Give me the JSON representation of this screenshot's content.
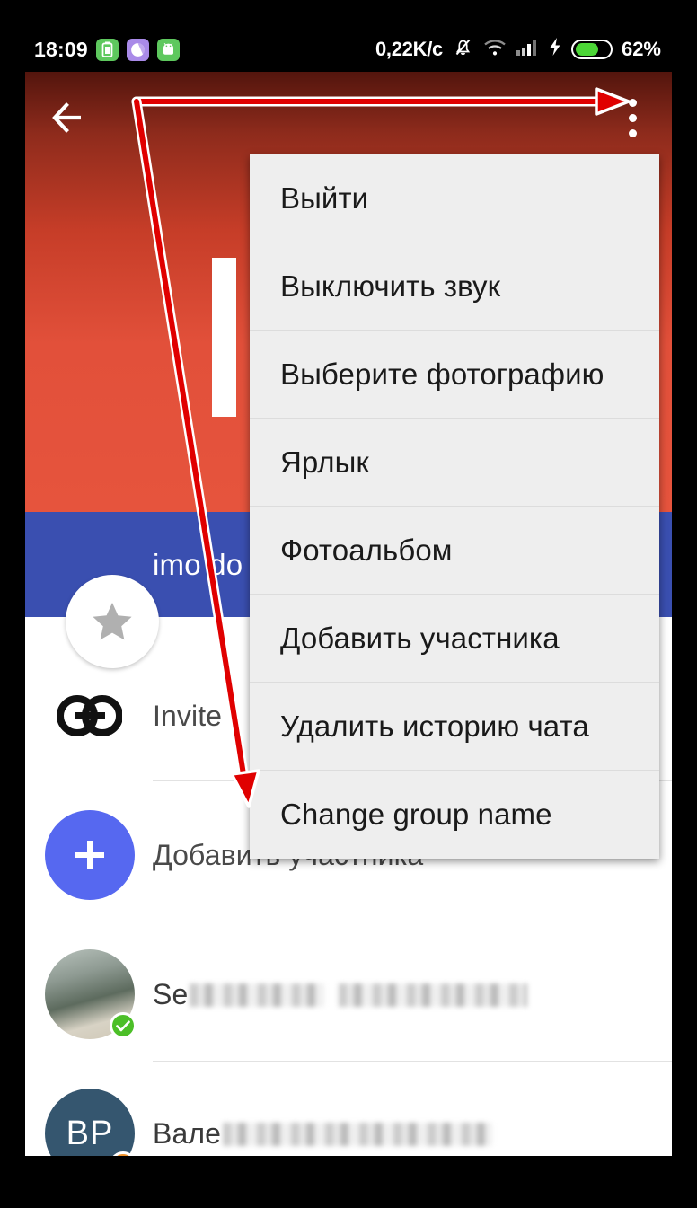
{
  "status_bar": {
    "clock": "18:09",
    "network_speed": "0,22K/c",
    "battery_percent": "62%",
    "icons": [
      {
        "name": "battery-saver-app-icon",
        "glyph": "battery"
      },
      {
        "name": "chat-app-icon",
        "glyph": "circle"
      },
      {
        "name": "android-robot-icon",
        "glyph": "android"
      },
      {
        "name": "mute-notifications-icon",
        "glyph": "bell-slash"
      },
      {
        "name": "wifi-icon",
        "glyph": "wifi"
      },
      {
        "name": "signal-bars-icon",
        "glyph": "signal"
      },
      {
        "name": "charging-bolt-icon",
        "glyph": "bolt"
      },
      {
        "name": "battery-icon",
        "glyph": "battery-full"
      }
    ],
    "battery_fill_percent": 62,
    "colors": {
      "background": "#000000",
      "text": "#ffffff",
      "battery_green": "#4cd637",
      "app_icon_green": "#5ec85e",
      "app_icon_purple": "#a98ae8"
    }
  },
  "app_bar": {
    "back_label": "←",
    "overflow_label": "⋮",
    "colors": {
      "gradient_top": "#53150d",
      "gradient_bottom": "#e6543d"
    }
  },
  "group_header": {
    "name": "imo do",
    "band_color": "#3a4fb0",
    "avatar_icon": "star-icon"
  },
  "overflow_menu": {
    "background": "#eeeeee",
    "items": [
      {
        "label": "Выйти",
        "name": "menu-item-leave"
      },
      {
        "label": "Выключить звук",
        "name": "menu-item-mute"
      },
      {
        "label": "Выберите фотографию",
        "name": "menu-item-choose-photo"
      },
      {
        "label": "Ярлык",
        "name": "menu-item-shortcut"
      },
      {
        "label": "Фотоальбом",
        "name": "menu-item-photo-album"
      },
      {
        "label": "Добавить участника",
        "name": "menu-item-add-member"
      },
      {
        "label": "Удалить историю чата",
        "name": "menu-item-delete-chat-history"
      },
      {
        "label": "Change group name",
        "name": "menu-item-change-group-name"
      }
    ]
  },
  "list": {
    "rows": [
      {
        "name": "row-invite-link",
        "label": "Invite",
        "icon": "link-icon",
        "type": "action"
      },
      {
        "name": "row-add-member",
        "label": "Добавить участника",
        "icon": "plus-icon",
        "type": "action"
      },
      {
        "name": "row-member-1",
        "label": "Se",
        "redacted": true,
        "icon": "photo-avatar",
        "badge": "verified-green-check",
        "type": "member"
      },
      {
        "name": "row-member-2",
        "label": "Вале",
        "redacted": true,
        "icon": "initials-avatar",
        "initials": "ВР",
        "badge": "orange-exclamation",
        "type": "member"
      }
    ]
  },
  "annotation": {
    "color": "#e00000",
    "outline_color": "#ffffff",
    "description": "arrow from overflow button to Change group name item"
  }
}
